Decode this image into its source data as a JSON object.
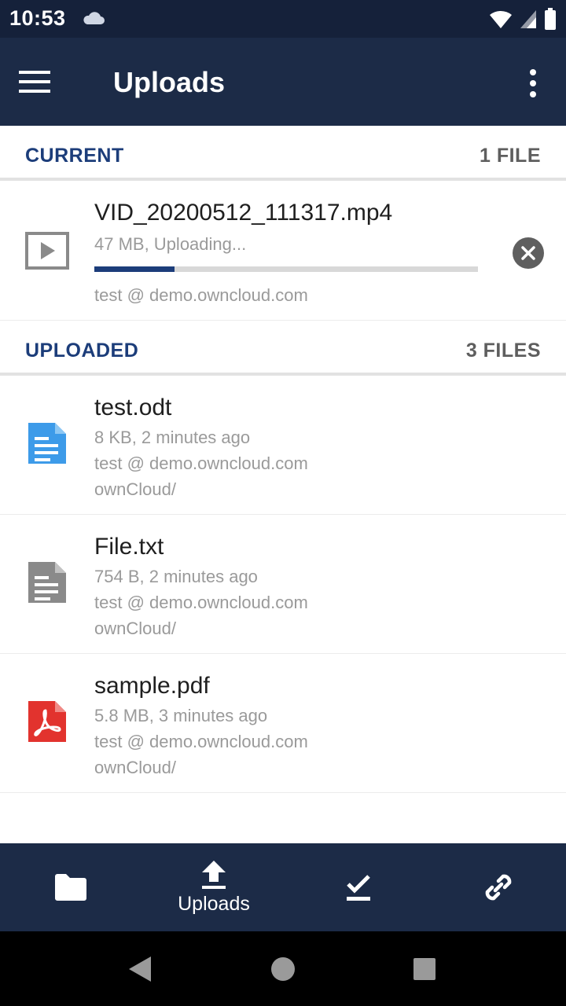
{
  "status_bar": {
    "time": "10:53",
    "icons": [
      "cloud-icon",
      "wifi-icon",
      "signal-icon",
      "battery-icon"
    ]
  },
  "app_bar": {
    "title": "Uploads",
    "icons": [
      "menu-icon",
      "more-vert-icon"
    ]
  },
  "current": {
    "title": "CURRENT",
    "count": "1 FILE",
    "item": {
      "name": "VID_20200512_111317.mp4",
      "status": "47 MB, Uploading...",
      "account": "test @ demo.owncloud.com",
      "progress": 0.21,
      "icon": "video-file-icon"
    }
  },
  "uploaded": {
    "title": "UPLOADED",
    "count": "3 FILES",
    "items": [
      {
        "name": "test.odt",
        "info": "8 KB,  2 minutes ago",
        "account": "test @ demo.owncloud.com",
        "path": "ownCloud/",
        "icon": "document-icon",
        "color": "#3d9be9"
      },
      {
        "name": "File.txt",
        "info": "754 B,  2 minutes ago",
        "account": "test @ demo.owncloud.com",
        "path": "ownCloud/",
        "icon": "text-file-icon",
        "color": "#8a8a8a"
      },
      {
        "name": "sample.pdf",
        "info": "5.8 MB,  3 minutes ago",
        "account": "test @ demo.owncloud.com",
        "path": "ownCloud/",
        "icon": "pdf-icon",
        "color": "#e2332e"
      }
    ]
  },
  "bottom_nav": {
    "items": [
      {
        "label": "",
        "icon": "folder-icon"
      },
      {
        "label": "Uploads",
        "icon": "upload-icon"
      },
      {
        "label": "",
        "icon": "available-offline-icon"
      },
      {
        "label": "",
        "icon": "shared-link-icon"
      }
    ]
  },
  "colors": {
    "primary": "#1c2b47",
    "accent": "#1c3d7a",
    "progress_track": "#d8d8d8"
  }
}
